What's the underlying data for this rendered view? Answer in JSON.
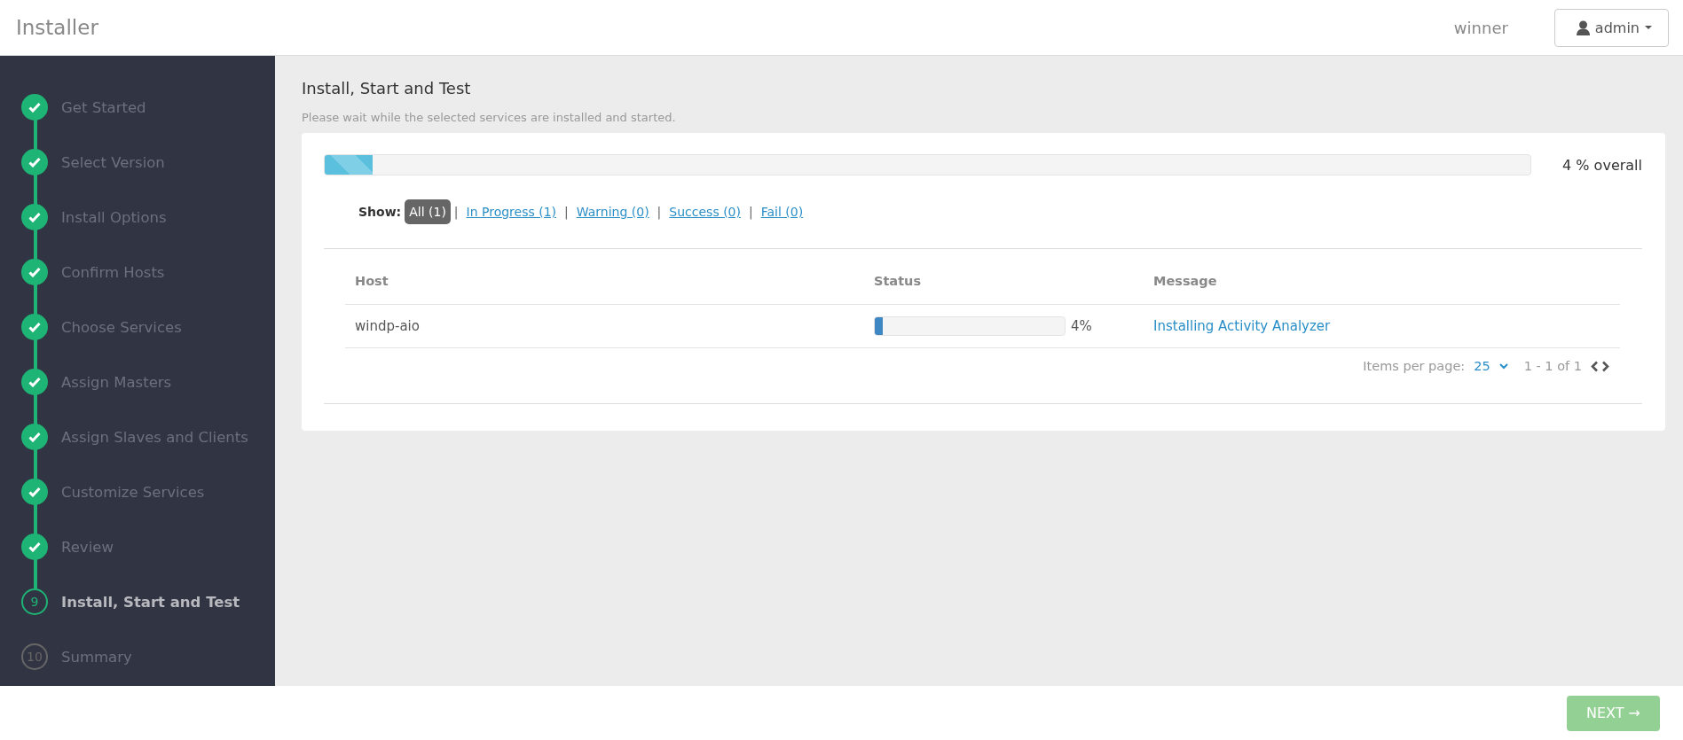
{
  "header": {
    "title": "Installer",
    "cluster_name": "winner",
    "user_menu": {
      "label": "admin"
    }
  },
  "sidebar": {
    "steps": [
      {
        "label": "Get Started",
        "completed": true,
        "selected": false
      },
      {
        "label": "Select Version",
        "completed": true,
        "selected": false
      },
      {
        "label": "Install Options",
        "completed": true,
        "selected": false
      },
      {
        "label": "Confirm Hosts",
        "completed": true,
        "selected": false
      },
      {
        "label": "Choose Services",
        "completed": true,
        "selected": false
      },
      {
        "label": "Assign Masters",
        "completed": true,
        "selected": false
      },
      {
        "label": "Assign Slaves and Clients",
        "completed": true,
        "selected": false
      },
      {
        "label": "Customize Services",
        "completed": true,
        "selected": false
      },
      {
        "label": "Review",
        "completed": true,
        "selected": false
      },
      {
        "label": "Install, Start and Test",
        "completed": false,
        "selected": true,
        "number": "9"
      },
      {
        "label": "Summary",
        "completed": false,
        "selected": false,
        "number": "10"
      }
    ]
  },
  "content": {
    "title": "Install, Start and Test",
    "subtitle": "Please wait while the selected services are installed and started.",
    "overall_progress": {
      "level": 0.04,
      "reading": "4 % overall"
    },
    "filter": {
      "label": "Show:",
      "separator": "|",
      "options": [
        {
          "label": "All (1)",
          "selected": true
        },
        {
          "label": "In Progress (1)",
          "selected": false
        },
        {
          "label": "Warning (0)",
          "selected": false
        },
        {
          "label": "Success (0)",
          "selected": false
        },
        {
          "label": "Fail (0)",
          "selected": false
        }
      ]
    },
    "table": {
      "columns": [
        "Host",
        "Status",
        "Message"
      ],
      "rows": [
        {
          "host": "windp-aio",
          "level": 0.04,
          "reading": "4%",
          "message": "Installing Activity Analyzer"
        }
      ]
    },
    "pagination": {
      "label": "Items per page:",
      "per_page": "25",
      "range": "1 - 1 of 1"
    }
  },
  "footer": {
    "next_button": {
      "label": "NEXT →",
      "disabled": true
    }
  }
}
